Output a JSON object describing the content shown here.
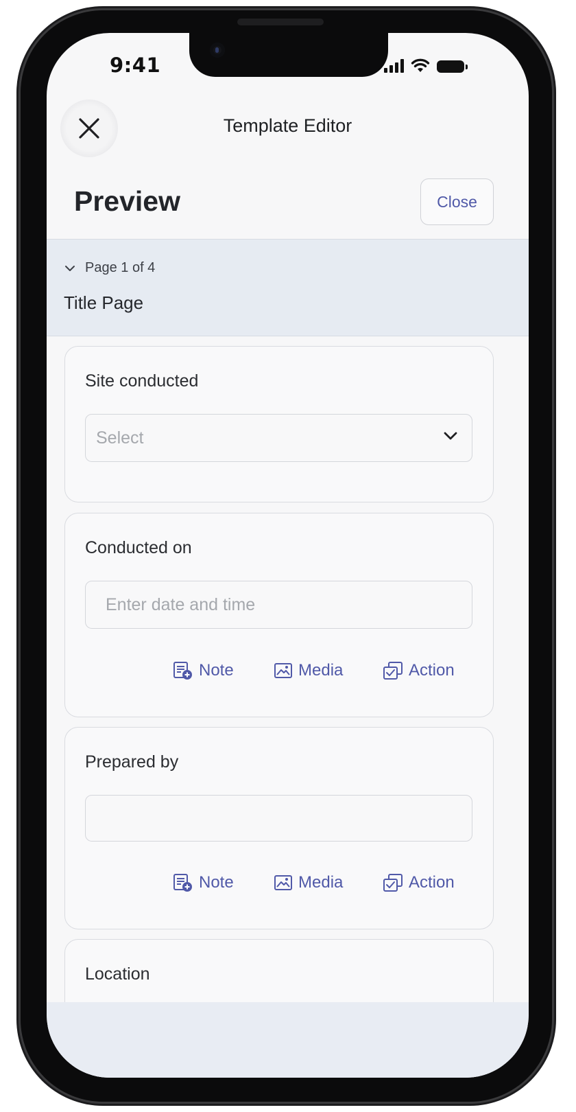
{
  "status_bar": {
    "time": "9:41"
  },
  "header": {
    "title": "Template Editor",
    "preview_title": "Preview",
    "close_label": "Close"
  },
  "page": {
    "indicator": "Page 1 of 4",
    "title": "Title Page"
  },
  "fields": [
    {
      "label": "Site conducted",
      "placeholder": "Select",
      "type": "select"
    },
    {
      "label": "Conducted on",
      "placeholder": "Enter date and time",
      "type": "input"
    },
    {
      "label": "Prepared by",
      "placeholder": "",
      "type": "input"
    },
    {
      "label": "Location"
    }
  ],
  "actions": {
    "note": "Note",
    "media": "Media",
    "action": "Action"
  },
  "colors": {
    "accent": "#5059a8",
    "page_band": "#e6ebf2",
    "screen_bg": "#f7f7f8"
  },
  "icons": [
    "close-icon",
    "chevron-down-icon",
    "note-icon",
    "media-icon",
    "action-icon",
    "signal-icon",
    "wifi-icon",
    "battery-icon"
  ]
}
